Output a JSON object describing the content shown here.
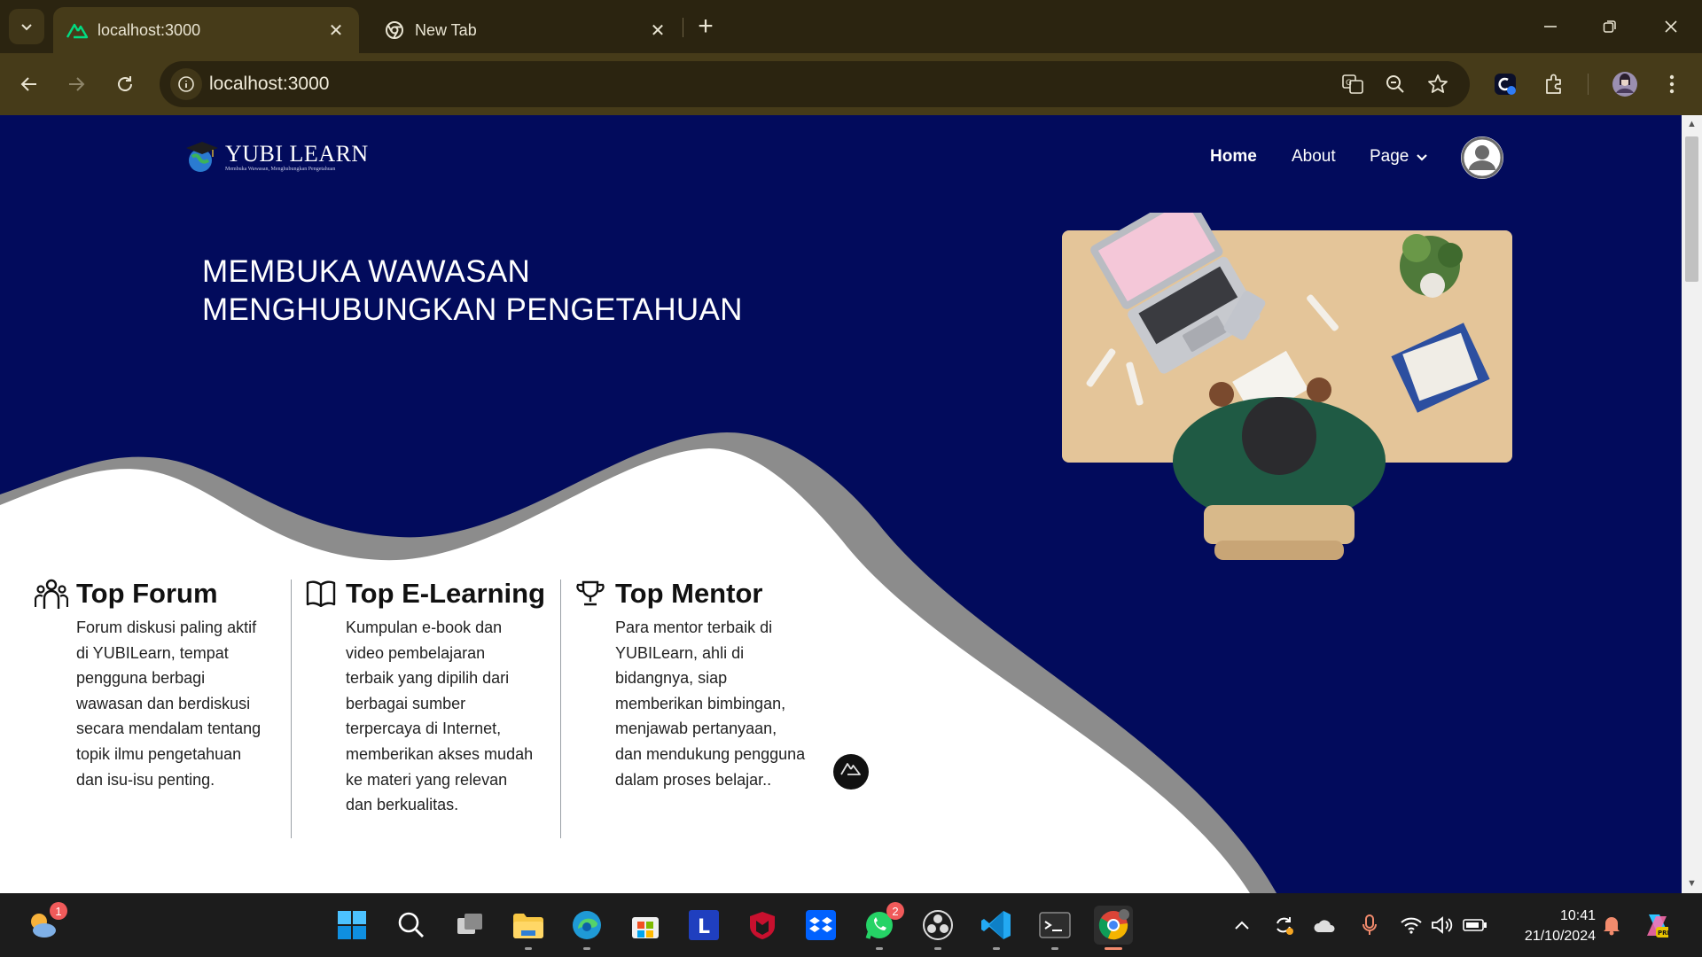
{
  "browser": {
    "tabs": [
      {
        "label": "localhost:3000",
        "active": true
      },
      {
        "label": "New Tab",
        "active": false
      }
    ],
    "address": "localhost:3000"
  },
  "site": {
    "logo_title": "YUBI LEARN",
    "logo_tagline": "Membuka Wawasan, Menghubungkan Pengetahuan",
    "nav": {
      "home": "Home",
      "about": "About",
      "page": "Page"
    },
    "hero_line1": "MEMBUKA WAWASAN",
    "hero_line2": "MENGHUBUNGKAN PENGETAHUAN",
    "features": [
      {
        "title": "Top Forum",
        "icon": "users-icon",
        "body": "Forum diskusi paling aktif di YUBILearn, tempat pengguna berbagi wawasan dan berdiskusi secara mendalam tentang topik ilmu pengetahuan dan isu-isu penting."
      },
      {
        "title": "Top E-Learning",
        "icon": "book-open-icon",
        "body": "Kumpulan e-book dan video pembelajaran terbaik yang dipilih dari berbagai sumber terpercaya di Internet, memberikan akses mudah ke materi yang relevan dan berkualitas."
      },
      {
        "title": "Top Mentor",
        "icon": "trophy-icon",
        "body": "Para mentor terbaik di YUBILearn, ahli di bidangnya, siap memberikan bimbingan, menjawab pertanyaan, dan mendukung pengguna dalam proses belajar.."
      }
    ],
    "colors": {
      "hero_bg": "#020b5c",
      "wave_gray": "#8c8c8c",
      "wave_white": "#ffffff"
    }
  },
  "taskbar": {
    "widgets_badge": "1",
    "whatsapp_badge": "2",
    "time": "10:41",
    "date": "21/10/2024"
  }
}
